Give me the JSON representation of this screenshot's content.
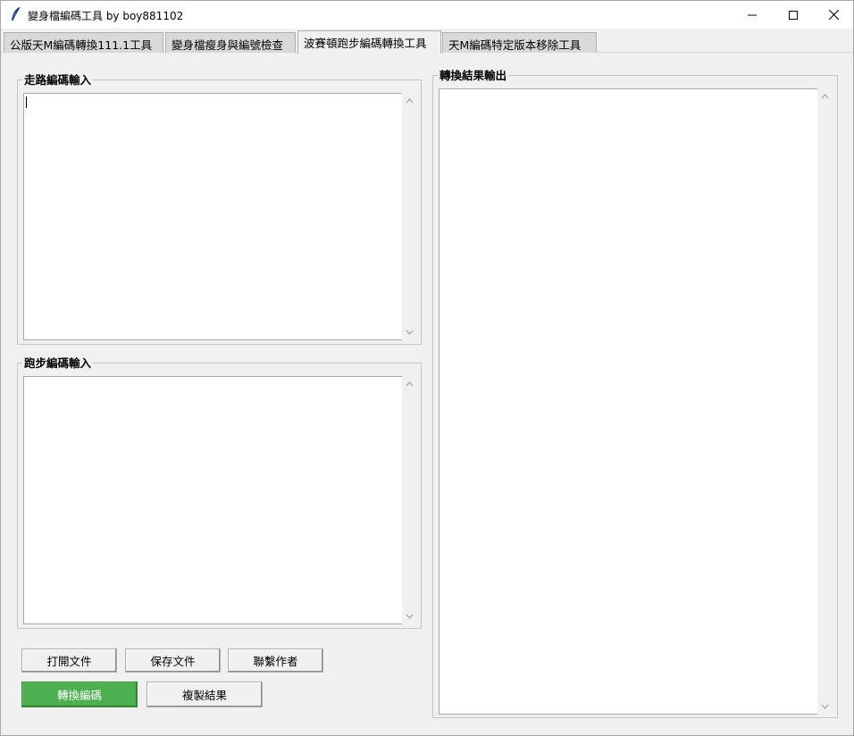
{
  "window": {
    "title": "變身檔編碼工具 by boy881102",
    "app_icon": "feather-icon"
  },
  "tabs": [
    {
      "label": "公版天M編碼轉換111.1工具",
      "active": false
    },
    {
      "label": "變身檔瘦身與編號檢查",
      "active": false
    },
    {
      "label": "波賽頓跑步編碼轉換工具",
      "active": true
    },
    {
      "label": "天M編碼特定版本移除工具",
      "active": false
    }
  ],
  "panels": {
    "walk_input": {
      "label": "走路編碼輸入",
      "value": ""
    },
    "run_input": {
      "label": "跑步編碼輸入",
      "value": ""
    },
    "output": {
      "label": "轉換結果輸出",
      "value": ""
    }
  },
  "buttons": {
    "open_file": "打開文件",
    "save_file": "保存文件",
    "contact_author": "聯繫作者",
    "convert": "轉換編碼",
    "copy_result": "複製結果"
  },
  "colors": {
    "convert_button": "#4caf50",
    "window_bg": "#f0f0f0"
  }
}
